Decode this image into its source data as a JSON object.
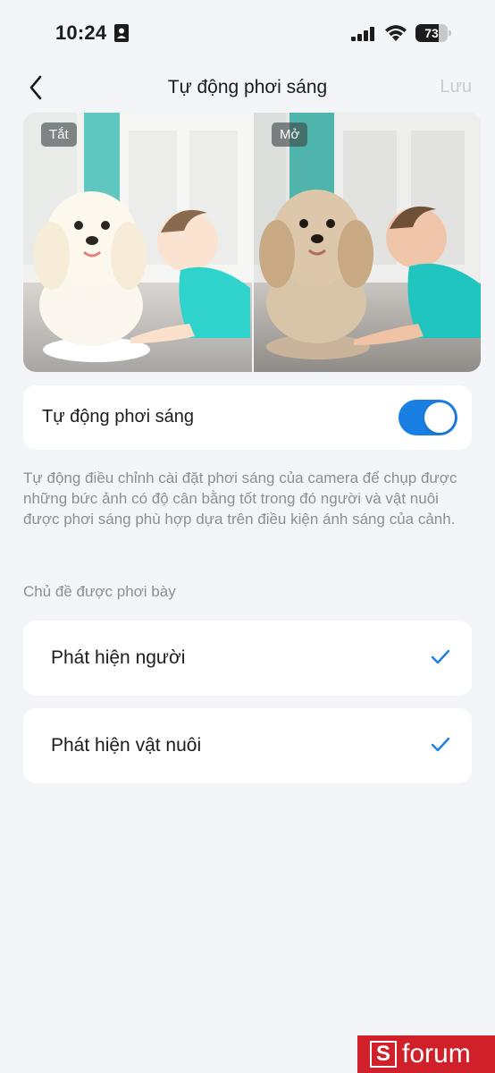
{
  "status_bar": {
    "time": "10:24",
    "battery": "73",
    "battery_level": 0.73
  },
  "nav": {
    "title": "Tự động phơi sáng",
    "save_label": "Lưu"
  },
  "preview": {
    "off_label": "Tắt",
    "on_label": "Mở"
  },
  "auto_exposure": {
    "label": "Tự động phơi sáng",
    "enabled": true,
    "accent_color": "#1a7fe2"
  },
  "description": "Tự động điều chỉnh cài đặt phơi sáng của camera để chụp được những bức ảnh có độ cân bằng tốt trong đó người và vật nuôi được phơi sáng phù hợp dựa trên điều kiện ánh sáng của cảnh.",
  "subjects": {
    "section_title": "Chủ đề được phơi bày",
    "options": [
      {
        "label": "Phát hiện người",
        "checked": true
      },
      {
        "label": "Phát hiện vật nuôi",
        "checked": true
      }
    ]
  },
  "watermark": {
    "letter": "S",
    "text": "forum",
    "color": "#d0202a"
  }
}
